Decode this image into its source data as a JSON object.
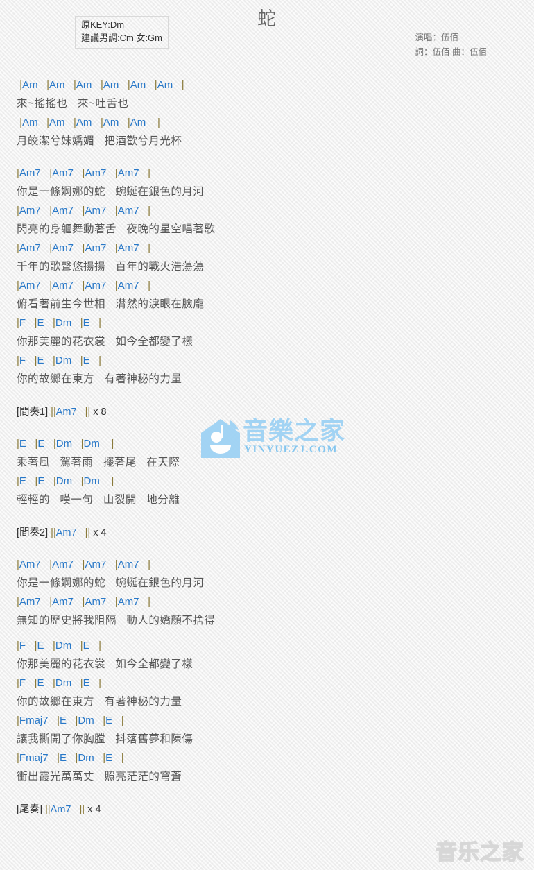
{
  "header": {
    "key_original": "原KEY:Dm",
    "key_suggested": "建議男調:Cm 女:Gm",
    "title": "蛇",
    "singer": "演唱：伍佰",
    "writers": "詞：伍佰  曲：伍佰"
  },
  "colors": {
    "chord": "#2878c8",
    "bar": "#8a7a3a",
    "lyric": "#565656",
    "title": "#666666",
    "credits": "#777777",
    "background": "#f4f4f4",
    "watermark_blue": "#9ed2f4",
    "watermark_grey": "#d6d6d6"
  },
  "watermark": {
    "center_cn": "音樂之家",
    "center_url": "YINYUEZJ.COM",
    "house_icon": "house-music-logo-icon",
    "bottom_cn": "音乐之家"
  },
  "sheet": [
    {
      "type": "pair",
      "chords": " |Am   |Am   |Am   |Am   |Am   |Am   |",
      "lyrics": "來~搖搖也   來~吐舌也"
    },
    {
      "type": "pair",
      "chords": " |Am   |Am   |Am   |Am   |Am    |",
      "lyrics": "月皎潔兮妹嬌媚   把酒歡兮月光杯"
    },
    {
      "type": "gap"
    },
    {
      "type": "pair",
      "chords": "|Am7   |Am7   |Am7   |Am7   |",
      "lyrics": "你是一條婀娜的蛇   蜿蜒在銀色的月河"
    },
    {
      "type": "pair",
      "chords": "|Am7   |Am7   |Am7   |Am7   |",
      "lyrics": "閃亮的身軀舞動著舌   夜晚的星空唱著歌"
    },
    {
      "type": "pair",
      "chords": "|Am7   |Am7   |Am7   |Am7   |",
      "lyrics": "千年的歌聲悠揚揚   百年的戰火浩蕩蕩"
    },
    {
      "type": "pair",
      "chords": "|Am7   |Am7   |Am7   |Am7   |",
      "lyrics": "俯看著前生今世相   潸然的淚眼在臉龐"
    },
    {
      "type": "pair",
      "chords": "|F   |E   |Dm   |E   |",
      "lyrics": "你那美麗的花衣裳   如今全都變了樣"
    },
    {
      "type": "pair",
      "chords": "|F   |E   |Dm   |E   |",
      "lyrics": "你的故鄉在東方   有著神秘的力量"
    },
    {
      "type": "gap"
    },
    {
      "type": "section",
      "tag": "[間奏1] ||",
      "chord": "Am7",
      "suffix": "   || x 8"
    },
    {
      "type": "gap"
    },
    {
      "type": "pair",
      "chords": "|E   |E   |Dm   |Dm    |",
      "lyrics": "乘著風   駕著雨   擺著尾   在天際"
    },
    {
      "type": "pair",
      "chords": "|E   |E   |Dm   |Dm    |",
      "lyrics": "輕輕的   嘆一句   山裂開   地分離"
    },
    {
      "type": "gap"
    },
    {
      "type": "section",
      "tag": "[間奏2] ||",
      "chord": "Am7",
      "suffix": "   || x 4"
    },
    {
      "type": "gap"
    },
    {
      "type": "pair",
      "chords": "|Am7   |Am7   |Am7   |Am7   |",
      "lyrics": "你是一條婀娜的蛇   蜿蜒在銀色的月河"
    },
    {
      "type": "pair",
      "chords": "|Am7   |Am7   |Am7   |Am7   |",
      "lyrics": "無知的歷史將我阻隔   動人的嬌顏不捨得"
    },
    {
      "type": "gap-sm"
    },
    {
      "type": "pair",
      "chords": "|F   |E   |Dm   |E   |",
      "lyrics": "你那美麗的花衣裳   如今全都變了樣"
    },
    {
      "type": "pair",
      "chords": "|F   |E   |Dm   |E   |",
      "lyrics": "你的故鄉在東方   有著神秘的力量"
    },
    {
      "type": "pair",
      "chords": "|Fmaj7   |E   |Dm   |E   |",
      "lyrics": "讓我撕開了你胸膛   抖落舊夢和陳傷"
    },
    {
      "type": "pair",
      "chords": "|Fmaj7   |E   |Dm   |E   |",
      "lyrics": "衝出霞光萬萬丈   照亮茫茫的穹蒼"
    },
    {
      "type": "gap"
    },
    {
      "type": "section",
      "tag": "[尾奏] ||",
      "chord": "Am7",
      "suffix": "   || x 4"
    }
  ]
}
